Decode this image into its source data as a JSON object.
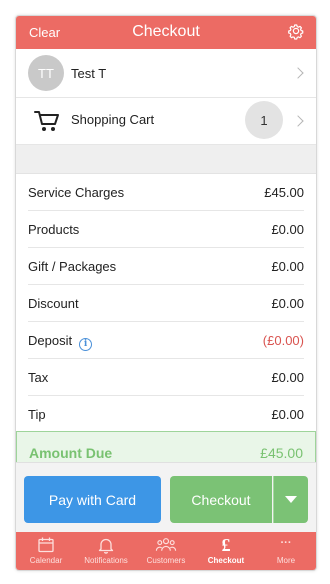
{
  "header": {
    "clear_label": "Clear",
    "title": "Checkout",
    "settings_icon": "gear-icon"
  },
  "client": {
    "initials": "TT",
    "name": "Test T"
  },
  "cart": {
    "label": "Shopping Cart",
    "count": "1",
    "icon": "cart-icon"
  },
  "summary": {
    "lines": [
      {
        "label": "Service Charges",
        "value": "£45.00"
      },
      {
        "label": "Products",
        "value": "£0.00"
      },
      {
        "label": "Gift / Packages",
        "value": "£0.00"
      },
      {
        "label": "Discount",
        "value": "£0.00"
      },
      {
        "label": "Deposit",
        "value": "(£0.00)"
      },
      {
        "label": "Tax",
        "value": "£0.00"
      },
      {
        "label": "Tip",
        "value": "£0.00"
      }
    ],
    "amount_due_label": "Amount Due",
    "amount_due_value": "£45.00"
  },
  "actions": {
    "pay_card_label": "Pay with Card",
    "checkout_label": "Checkout"
  },
  "tabs": [
    {
      "label": "Calendar",
      "icon": "calendar-icon"
    },
    {
      "label": "Notifications",
      "icon": "bell-icon"
    },
    {
      "label": "Customers",
      "icon": "people-icon"
    },
    {
      "label": "Checkout",
      "icon": "pound-icon",
      "glyph": "£",
      "active": true
    },
    {
      "label": "More",
      "icon": "more-icon",
      "glyph": "···"
    }
  ],
  "colors": {
    "accent": "#ec6b64",
    "pay_button": "#3d96e6",
    "checkout_button": "#7bc275",
    "amount_due": "#79c271",
    "negative": "#d9534f"
  }
}
